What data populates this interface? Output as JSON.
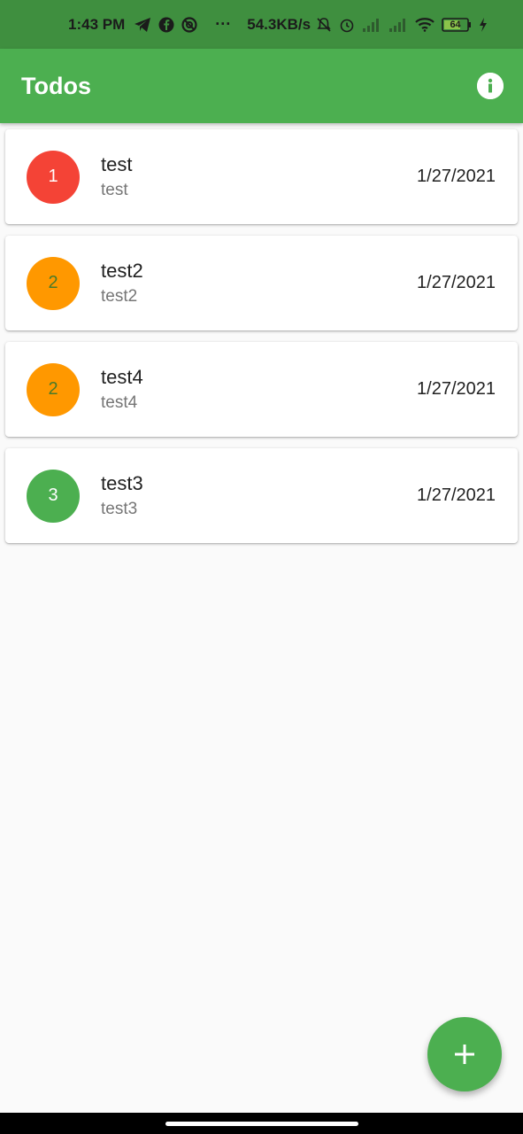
{
  "status_bar": {
    "time": "1:43 PM",
    "more": "···",
    "network_speed": "54.3KB/s",
    "battery_level": "64",
    "icons": [
      "telegram-icon",
      "facebook-icon",
      "app-icon",
      "mute-icon",
      "alarm-icon",
      "signal-icon",
      "signal-icon",
      "wifi-icon",
      "battery-icon",
      "charging-icon"
    ]
  },
  "app_bar": {
    "title": "Todos",
    "info_icon": "info-icon"
  },
  "todos": [
    {
      "priority": "1",
      "title": "test",
      "subtitle": "test",
      "date": "1/27/2021",
      "color": "#f44336"
    },
    {
      "priority": "2",
      "title": "test2",
      "subtitle": "test2",
      "date": "1/27/2021",
      "color": "#ff9800"
    },
    {
      "priority": "2",
      "title": "test4",
      "subtitle": "test4",
      "date": "1/27/2021",
      "color": "#ff9800"
    },
    {
      "priority": "3",
      "title": "test3",
      "subtitle": "test3",
      "date": "1/27/2021",
      "color": "#4caf50"
    }
  ],
  "fab": {
    "icon": "add-icon"
  },
  "colors": {
    "primary": "#4caf50",
    "status_bar": "#3f8f3f",
    "background": "#fafafa"
  }
}
